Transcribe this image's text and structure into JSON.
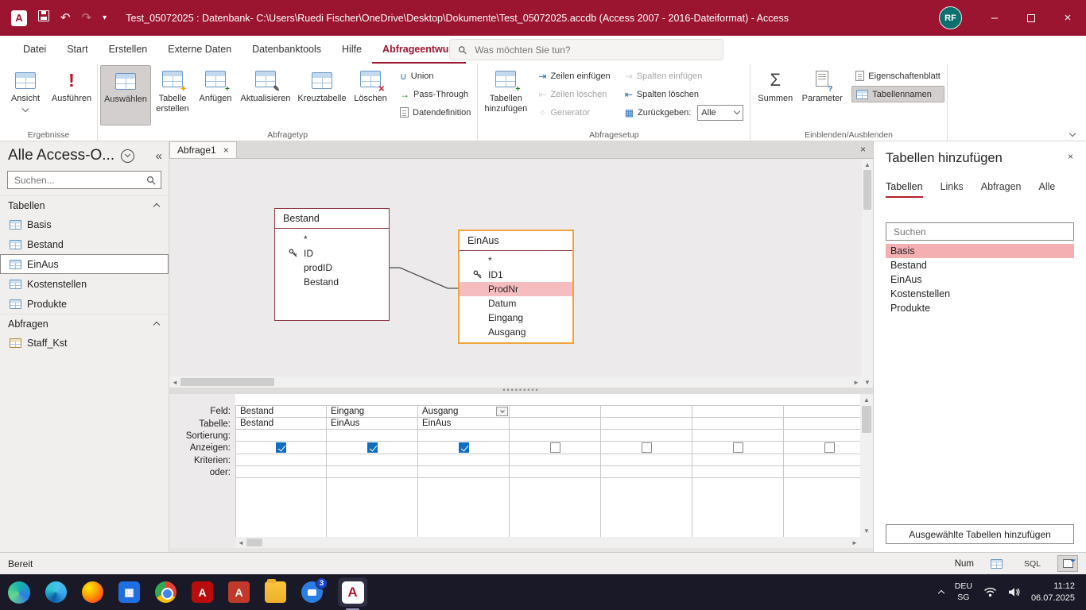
{
  "titlebar": {
    "title": "Test_05072025 : Datenbank- C:\\Users\\Ruedi Fischer\\OneDrive\\Desktop\\Dokumente\\Test_05072025.accdb (Access 2007 - 2016-Dateiformat)  -  Access",
    "avatar_initials": "RF"
  },
  "ribbon_tabs": {
    "datei": "Datei",
    "start": "Start",
    "erstellen": "Erstellen",
    "externe_daten": "Externe Daten",
    "datenbanktools": "Datenbanktools",
    "hilfe": "Hilfe",
    "abfrageentwurf": "Abfrageentwurf"
  },
  "search": {
    "placeholder": "Was möchten Sie tun?"
  },
  "ribbon": {
    "ansicht": "Ansicht",
    "ausfuehren": "Ausführen",
    "ergebnisse_label": "Ergebnisse",
    "auswaehlen": "Auswählen",
    "tabelle_erstellen": "Tabelle erstellen",
    "anfuegen": "Anfügen",
    "aktualisieren": "Aktualisieren",
    "kreuztabelle": "Kreuztabelle",
    "loeschen": "Löschen",
    "union": "Union",
    "pass_through": "Pass-Through",
    "datendefinition": "Datendefinition",
    "abfragetyp_label": "Abfragetyp",
    "tabellen_hinzufuegen": "Tabellen hinzufügen",
    "zeilen_einfuegen": "Zeilen einfügen",
    "zeilen_loeschen": "Zeilen löschen",
    "generator": "Generator",
    "spalten_einfuegen": "Spalten einfügen",
    "spalten_loeschen": "Spalten löschen",
    "zurueckgeben": "Zurückgeben:",
    "zurueckgeben_value": "Alle",
    "abfragesetup_label": "Abfragesetup",
    "summen": "Summen",
    "parameter": "Parameter",
    "eigenschaftenblatt": "Eigenschaftenblatt",
    "tabellennamen": "Tabellennamen",
    "einblenden_label": "Einblenden/Ausblenden"
  },
  "nav": {
    "title": "Alle Access-O...",
    "search_placeholder": "Suchen...",
    "tables_header": "Tabellen",
    "queries_header": "Abfragen",
    "tables": [
      "Basis",
      "Bestand",
      "EinAus",
      "Kostenstellen",
      "Produkte"
    ],
    "queries": [
      "Staff_Kst"
    ]
  },
  "doc": {
    "tab": "Abfrage1",
    "table1": {
      "title": "Bestand",
      "f0": "*",
      "f1": "ID",
      "f2": "prodID",
      "f3": "Bestand"
    },
    "table2": {
      "title": "EinAus",
      "f0": "*",
      "f1": "ID1",
      "f2": "ProdNr",
      "f3": "Datum",
      "f4": "Eingang",
      "f5": "Ausgang"
    }
  },
  "grid": {
    "rows": {
      "feld": "Feld:",
      "tabelle": "Tabelle:",
      "sortierung": "Sortierung:",
      "anzeigen": "Anzeigen:",
      "kriterien": "Kriterien:",
      "oder": "oder:"
    },
    "columns": [
      {
        "feld": "Bestand",
        "tabelle": "Bestand",
        "checked": true
      },
      {
        "feld": "Eingang",
        "tabelle": "EinAus",
        "checked": true
      },
      {
        "feld": "Ausgang",
        "tabelle": "EinAus",
        "checked": true
      },
      {
        "feld": "",
        "tabelle": "",
        "checked": false
      },
      {
        "feld": "",
        "tabelle": "",
        "checked": false
      },
      {
        "feld": "",
        "tabelle": "",
        "checked": false
      },
      {
        "feld": "",
        "tabelle": "",
        "checked": false
      }
    ]
  },
  "panel": {
    "title": "Tabellen hinzufügen",
    "tabs": {
      "tabellen": "Tabellen",
      "links": "Links",
      "abfragen": "Abfragen",
      "alle": "Alle"
    },
    "search_placeholder": "Suchen",
    "items": [
      "Basis",
      "Bestand",
      "EinAus",
      "Kostenstellen",
      "Produkte"
    ],
    "add_button": "Ausgewählte Tabellen hinzufügen"
  },
  "statusbar": {
    "ready": "Bereit",
    "num": "Num",
    "sql": "SQL"
  },
  "taskbar": {
    "badge": "3"
  },
  "tray": {
    "lang_top": "DEU",
    "lang_bottom": "SG",
    "time": "11:12",
    "date": "06.07.2025"
  }
}
